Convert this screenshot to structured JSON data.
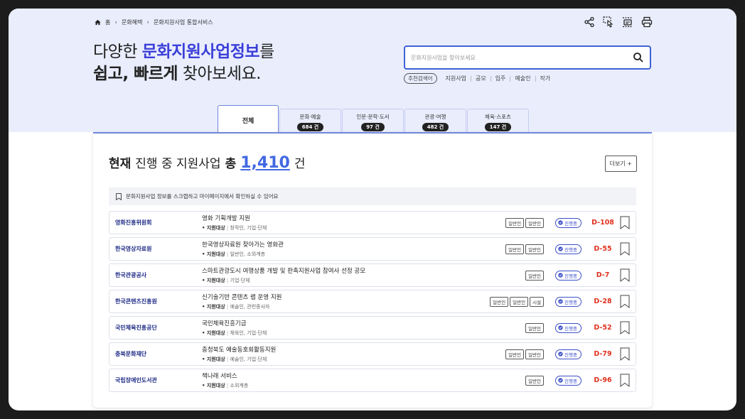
{
  "breadcrumb": [
    "홈",
    "문화혜택",
    "문화지원사업 통합서비스"
  ],
  "toolbar": {
    "icons": [
      "share-icon",
      "touch-icon",
      "scrap-icon",
      "print-icon"
    ]
  },
  "headline": {
    "line1_prefix": "다양한 ",
    "line1_highlight": "문화지원사업정보",
    "line1_suffix": "를",
    "line2_bold": "쉽고, 빠르게",
    "line2_rest": " 찾아보세요."
  },
  "search": {
    "placeholder": "문화지원사업을 찾아보세요"
  },
  "keywords": {
    "label": "추천검색어",
    "items": [
      "지원사업",
      "공모",
      "입주",
      "예술인",
      "작가"
    ]
  },
  "tabs": [
    {
      "label": "전체",
      "count": ""
    },
    {
      "label": "문화·예술",
      "count": "684 건"
    },
    {
      "label": "인문·문학·도서",
      "count": "97 건"
    },
    {
      "label": "관광·여행",
      "count": "482 건"
    },
    {
      "label": "체육·스포츠",
      "count": "147 건"
    }
  ],
  "summary": {
    "prefix_bold": "현재",
    "prefix": "진행 중 지원사업",
    "total_label": "총",
    "total": "1,410",
    "unit": "건",
    "more_label": "더보기 +"
  },
  "notice": "문화지원사업 정보를 스크랩하고 마이페이지에서 확인하실 수 있어요",
  "status_label": "진행중",
  "target_label": "• 지원대상",
  "rows": [
    {
      "org": "영화진흥위원회",
      "title": "영화 기획개발 지원",
      "target": "창작인, 기업·단체",
      "tags": [
        "일반인",
        "일반인"
      ],
      "dday": "D-108"
    },
    {
      "org": "한국영상자료원",
      "title": "한국영상자료원 찾아가는 영화관",
      "target": "일반인, 소외계층",
      "tags": [
        "일반인",
        "일반인"
      ],
      "dday": "D-55"
    },
    {
      "org": "한국관광공사",
      "title": "스마트관광도시 여행상품 개발 및 판촉지원사업 참여사 선정 공모",
      "target": "기업·단체",
      "tags": [
        "일반인"
      ],
      "dday": "D-7"
    },
    {
      "org": "한국콘텐츠진흥원",
      "title": "신기술기반 콘텐츠 랩 운영 지원",
      "target": "예술인, 관련종사자",
      "tags": [
        "일반인",
        "일반인",
        "시설"
      ],
      "dday": "D-28"
    },
    {
      "org": "국민체육진흥공단",
      "title": "국민체육진흥기금",
      "target": "체육인, 기업·단체",
      "tags": [
        "일반인"
      ],
      "dday": "D-52"
    },
    {
      "org": "충북문화재단",
      "title": "충청북도 예술동호회활동지원",
      "target": "예술인, 기업·단체",
      "tags": [
        "일반인",
        "일반인"
      ],
      "dday": "D-79"
    },
    {
      "org": "국립장애인도서관",
      "title": "책나래 서비스",
      "target": "소외계층",
      "tags": [
        "일반인"
      ],
      "dday": "D-96"
    }
  ]
}
